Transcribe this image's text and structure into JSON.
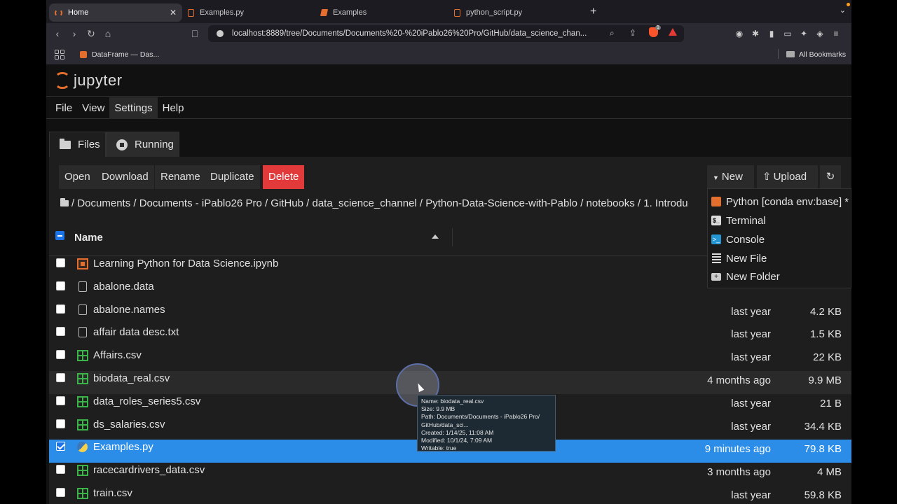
{
  "browser": {
    "tabs": [
      {
        "label": "Home",
        "active": true
      },
      {
        "label": "Examples.py",
        "active": false
      },
      {
        "label": "Examples",
        "active": false
      },
      {
        "label": "python_script.py",
        "active": false
      }
    ],
    "new_tab": "+",
    "url": "localhost:8889/tree/Documents/Documents%20-%20iPablo26%20Pro/GitHub/data_science_chan...",
    "brave_badge": "1",
    "bookmarks": [
      {
        "label": "DataFrame — Das..."
      }
    ],
    "all_bookmarks": "All Bookmarks"
  },
  "jupyter": {
    "logo_text": "jupyter",
    "menu": [
      {
        "label": "File"
      },
      {
        "label": "View"
      },
      {
        "label": "Settings"
      },
      {
        "label": "Help"
      }
    ],
    "tabs": {
      "files": "Files",
      "running": "Running"
    },
    "toolbar": {
      "open": "Open",
      "download": "Download",
      "rename": "Rename",
      "duplicate": "Duplicate",
      "delete": "Delete",
      "new": "New",
      "upload": "Upload"
    },
    "breadcrumb": "/ Documents / Documents - iPablo26 Pro / GitHub / data_science_channel / Python-Data-Science-with-Pablo / notebooks / 1. Introdu",
    "header": {
      "name": "Name"
    },
    "files": [
      {
        "name": "Learning Python for Data Science.ipynb",
        "type": "notebook",
        "modified": "",
        "size": ""
      },
      {
        "name": "abalone.data",
        "type": "doc",
        "modified": "",
        "size": ""
      },
      {
        "name": "abalone.names",
        "type": "doc",
        "modified": "last year",
        "size": "4.2 KB"
      },
      {
        "name": "affair data desc.txt",
        "type": "doc",
        "modified": "last year",
        "size": "1.5 KB"
      },
      {
        "name": "Affairs.csv",
        "type": "csv",
        "modified": "last year",
        "size": "22 KB"
      },
      {
        "name": "biodata_real.csv",
        "type": "csv",
        "modified": "4 months ago",
        "size": "9.9 MB"
      },
      {
        "name": "data_roles_series5.csv",
        "type": "csv",
        "modified": "last year",
        "size": "21 B"
      },
      {
        "name": "ds_salaries.csv",
        "type": "csv",
        "modified": "last year",
        "size": "34.4 KB"
      },
      {
        "name": "Examples.py",
        "type": "py",
        "modified": "9 minutes ago",
        "size": "79.8 KB"
      },
      {
        "name": "racecardrivers_data.csv",
        "type": "csv",
        "modified": "3 months ago",
        "size": "4 MB"
      },
      {
        "name": "train.csv",
        "type": "csv",
        "modified": "last year",
        "size": "59.8 KB"
      }
    ],
    "new_menu": [
      {
        "label": "Python [conda env:base] *",
        "icon": "python-kernel-icon"
      },
      {
        "label": "Terminal",
        "icon": "terminal-icon"
      },
      {
        "label": "Console",
        "icon": "console-icon"
      },
      {
        "label": "New File",
        "icon": "text-file-icon"
      },
      {
        "label": "New Folder",
        "icon": "new-folder-icon"
      }
    ],
    "tooltip": [
      "Name: biodata_real.csv",
      "Size: 9.9 MB",
      "Path: Documents/Documents - iPablo26 Pro/",
      "GitHub/data_sci...",
      "Created: 1/14/25, 11:08 AM",
      "Modified: 10/1/24, 7:09 AM",
      "Writable: true"
    ]
  },
  "colors": {
    "accent": "#e46e2e",
    "delete": "#e23a3a",
    "selected": "#2b8de8",
    "csv_icon": "#3bb54a"
  }
}
